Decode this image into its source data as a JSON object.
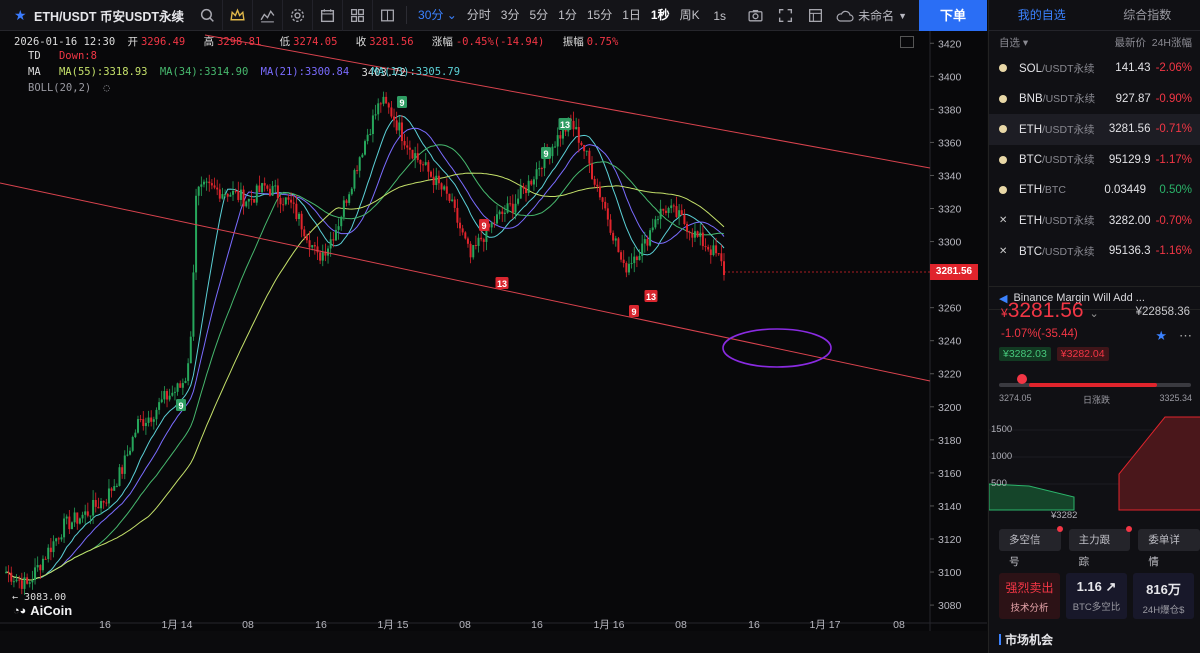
{
  "toolbar": {
    "symbol": "ETH/USDT 币安USDT永续",
    "timeframes": [
      "30分",
      "分时",
      "3分",
      "5分",
      "1分",
      "15分",
      "1日",
      "1秒",
      "周K"
    ],
    "active_timeframe": "30分",
    "bold_timeframe": "1秒",
    "one_s": "1s",
    "layout_name": "未命名",
    "order_button": "下单"
  },
  "ohlc": {
    "datetime": "2026-01-16 12:30",
    "open_label": "开",
    "open": "3296.49",
    "high_label": "高",
    "high": "3298.81",
    "low_label": "低",
    "low": "3274.05",
    "close_label": "收",
    "close": "3281.56",
    "change_label": "涨幅",
    "change": "-0.45%(-14.94)",
    "amp_label": "振幅",
    "amp": "0.75%"
  },
  "indicators": {
    "td_label": "TD",
    "td_value": "Down:8",
    "ma_label": "MA",
    "ma55": "MA(55):3318.93",
    "ma34": "MA(34):3314.90",
    "ma21": "MA(21):3300.84",
    "ma_last": "MA(13):3305.79",
    "ma_overlap": "3403.72",
    "boll_label": "BOLL(20,2)"
  },
  "chart_data": {
    "type": "candlestick",
    "y_axis": {
      "min": 3074,
      "max": 3425,
      "ticks": [
        3420,
        3400,
        3380,
        3360,
        3340,
        3320,
        3300,
        3280,
        3260,
        3240,
        3220,
        3200,
        3180,
        3160,
        3140,
        3120,
        3100,
        3080
      ]
    },
    "x_ticks": [
      "16",
      "1月 14",
      "08",
      "16",
      "1月 15",
      "08",
      "16",
      "1月 16",
      "08",
      "16",
      "1月 17",
      "08"
    ],
    "last_price": "3281.56",
    "low_marker": "3083.00",
    "td_markers": [
      {
        "label": "9",
        "type": "sell",
        "price": 3202
      },
      {
        "label": "9",
        "type": "sell",
        "price": 3392
      },
      {
        "label": "13",
        "type": "sell",
        "price": 3381
      },
      {
        "label": "9",
        "type": "sell",
        "price": 3353
      },
      {
        "label": "9",
        "type": "buy",
        "price": 3305
      },
      {
        "label": "13",
        "type": "buy",
        "price": 3275
      },
      {
        "label": "9",
        "type": "buy",
        "price": 3256
      },
      {
        "label": "13",
        "type": "buy",
        "price": 3264
      }
    ],
    "colors": {
      "up": "#26a65b",
      "down": "#e0242c",
      "ma13": "#5bd0d6",
      "ma21": "#7a6cff",
      "ma34": "#47b86e",
      "ma55": "#c4e06a",
      "trend": "#d9434e",
      "ellipse": "#8a2be2"
    }
  },
  "watermark": "AiCoin",
  "side": {
    "tabs": [
      "我的自选",
      "综合指数"
    ],
    "head": [
      "自选",
      "最新价",
      "24H涨幅"
    ],
    "watchlist": [
      {
        "mark": "dot",
        "base": "SOL",
        "quote": "/USDT永续",
        "price": "141.43",
        "change": "-2.06%",
        "dir": "down"
      },
      {
        "mark": "dot",
        "base": "BNB",
        "quote": "/USDT永续",
        "price": "927.87",
        "change": "-0.90%",
        "dir": "down"
      },
      {
        "mark": "dot",
        "base": "ETH",
        "quote": "/USDT永续",
        "price": "3281.56",
        "change": "-0.71%",
        "dir": "down",
        "selected": true
      },
      {
        "mark": "dot",
        "base": "BTC",
        "quote": "/USDT永续",
        "price": "95129.9",
        "change": "-1.17%",
        "dir": "down"
      },
      {
        "mark": "dot",
        "base": "ETH",
        "quote": "/BTC",
        "price": "0.03449",
        "change": "0.50%",
        "dir": "up"
      },
      {
        "mark": "x",
        "base": "ETH",
        "quote": "/USDT永续",
        "price": "3282.00",
        "change": "-0.70%",
        "dir": "down"
      },
      {
        "mark": "x",
        "base": "BTC",
        "quote": "/USDT永续",
        "price": "95136.3",
        "change": "-1.16%",
        "dir": "down"
      }
    ],
    "news": "Binance Margin Will Add ...",
    "price_currency": "¥",
    "big_price": "3281.56",
    "volume": "¥22858.36",
    "change_line": "-1.07%(-35.44)",
    "bid": "¥3282.03",
    "ask": "¥3282.04",
    "day_low": "3274.05",
    "range_label": "日涨跌",
    "day_high": "3325.34",
    "depth_levels": [
      "1500",
      "1000",
      "500"
    ],
    "depth_price": "¥3282",
    "pills": [
      "多空信号",
      "主力跟踪",
      "委单详情"
    ],
    "cards": [
      {
        "value": "强烈卖出",
        "label": "技术分析",
        "red": true
      },
      {
        "value": "1.16 ↗",
        "label": "BTC多空比"
      },
      {
        "value": "816万",
        "label": "24H爆仓$"
      }
    ],
    "market": "市场机会"
  }
}
